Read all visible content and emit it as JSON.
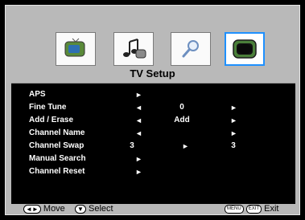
{
  "header": {
    "title": "TV Setup",
    "icons": [
      {
        "name": "tv-icon",
        "selected": false
      },
      {
        "name": "music-notes-icon",
        "selected": false
      },
      {
        "name": "magnifier-icon",
        "selected": false
      },
      {
        "name": "tv-setup-icon",
        "selected": true
      }
    ]
  },
  "menu": {
    "items": [
      {
        "label": "APS",
        "arrow": "►"
      },
      {
        "label": "Fine Tune",
        "left": "◄",
        "value": "0",
        "right": "►"
      },
      {
        "label": "Add  /  Erase",
        "left": "◄",
        "value": "Add",
        "right": "►"
      },
      {
        "label": "Channel Name",
        "left": "◄",
        "right": "►"
      },
      {
        "label": "Channel Swap",
        "value_left": "3",
        "mid": "►",
        "value_right": "3"
      },
      {
        "label": "Manual Search",
        "arrow": "►"
      },
      {
        "label": "Channel Reset",
        "arrow": "►"
      }
    ]
  },
  "footer": {
    "move_label": "Move",
    "select_label": "Select",
    "menu_btn": "MENU",
    "exit_btn": "EXIT",
    "exit_label": "Exit"
  },
  "colors": {
    "accent": "#1e90ff"
  }
}
